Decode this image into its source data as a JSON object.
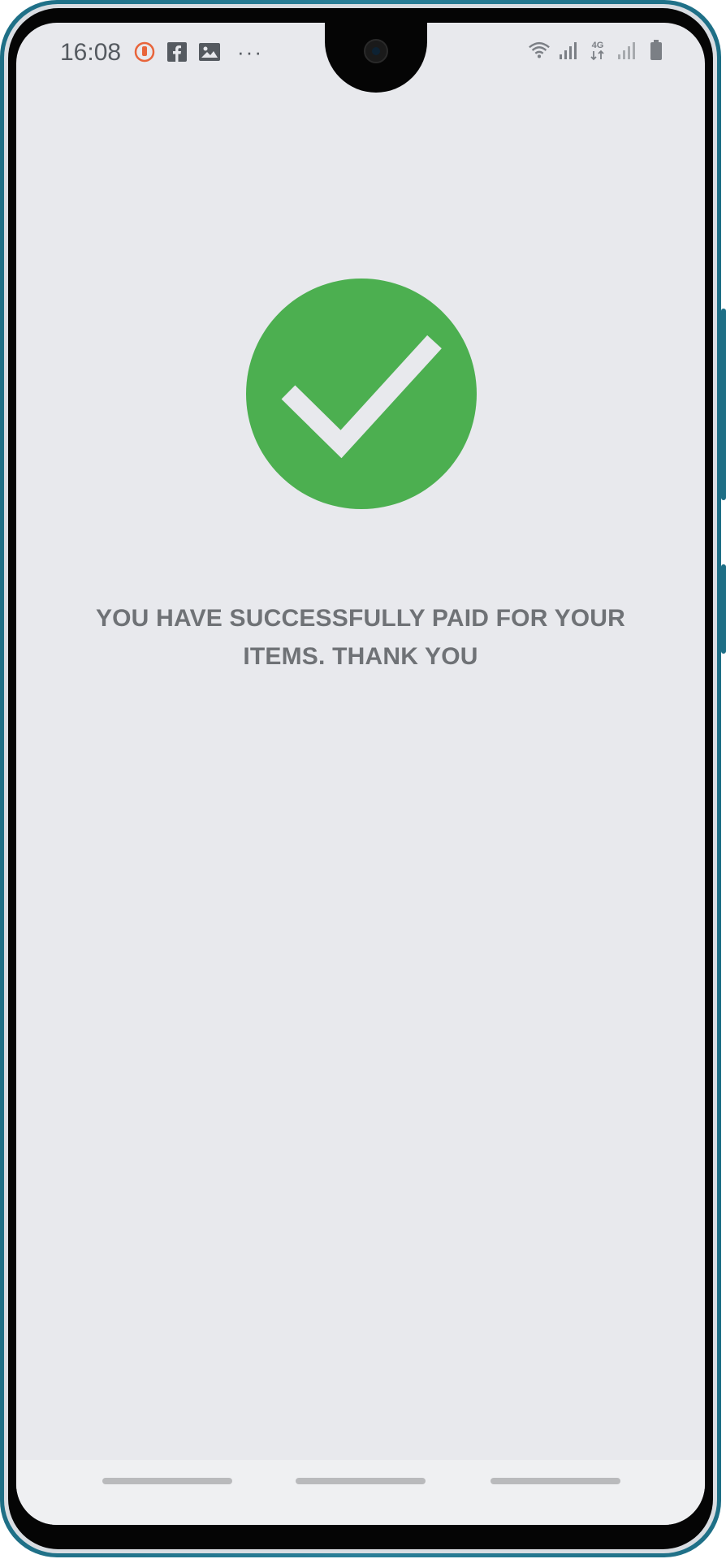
{
  "status_bar": {
    "time": "16:08",
    "left_icons": [
      "stopwatch-notification-icon",
      "facebook-icon",
      "gallery-icon",
      "more-notifications-icon"
    ],
    "more_glyph": "···",
    "network_label": "4G",
    "right_icons": [
      "wifi-icon",
      "signal-icon",
      "4g-icon",
      "signal-2-icon",
      "battery-icon"
    ]
  },
  "payment": {
    "status_icon": "check-circle-icon",
    "message": "YOU HAVE SUCCESSFULLY PAID FOR YOUR ITEMS. THANK YOU"
  },
  "navigation": {
    "items": [
      "recent-apps",
      "home",
      "back"
    ]
  },
  "colors": {
    "success_green": "#4caf50",
    "background": "#e8e9ed",
    "message_text": "#6f7276",
    "phone_frame": "#1e6f86"
  }
}
